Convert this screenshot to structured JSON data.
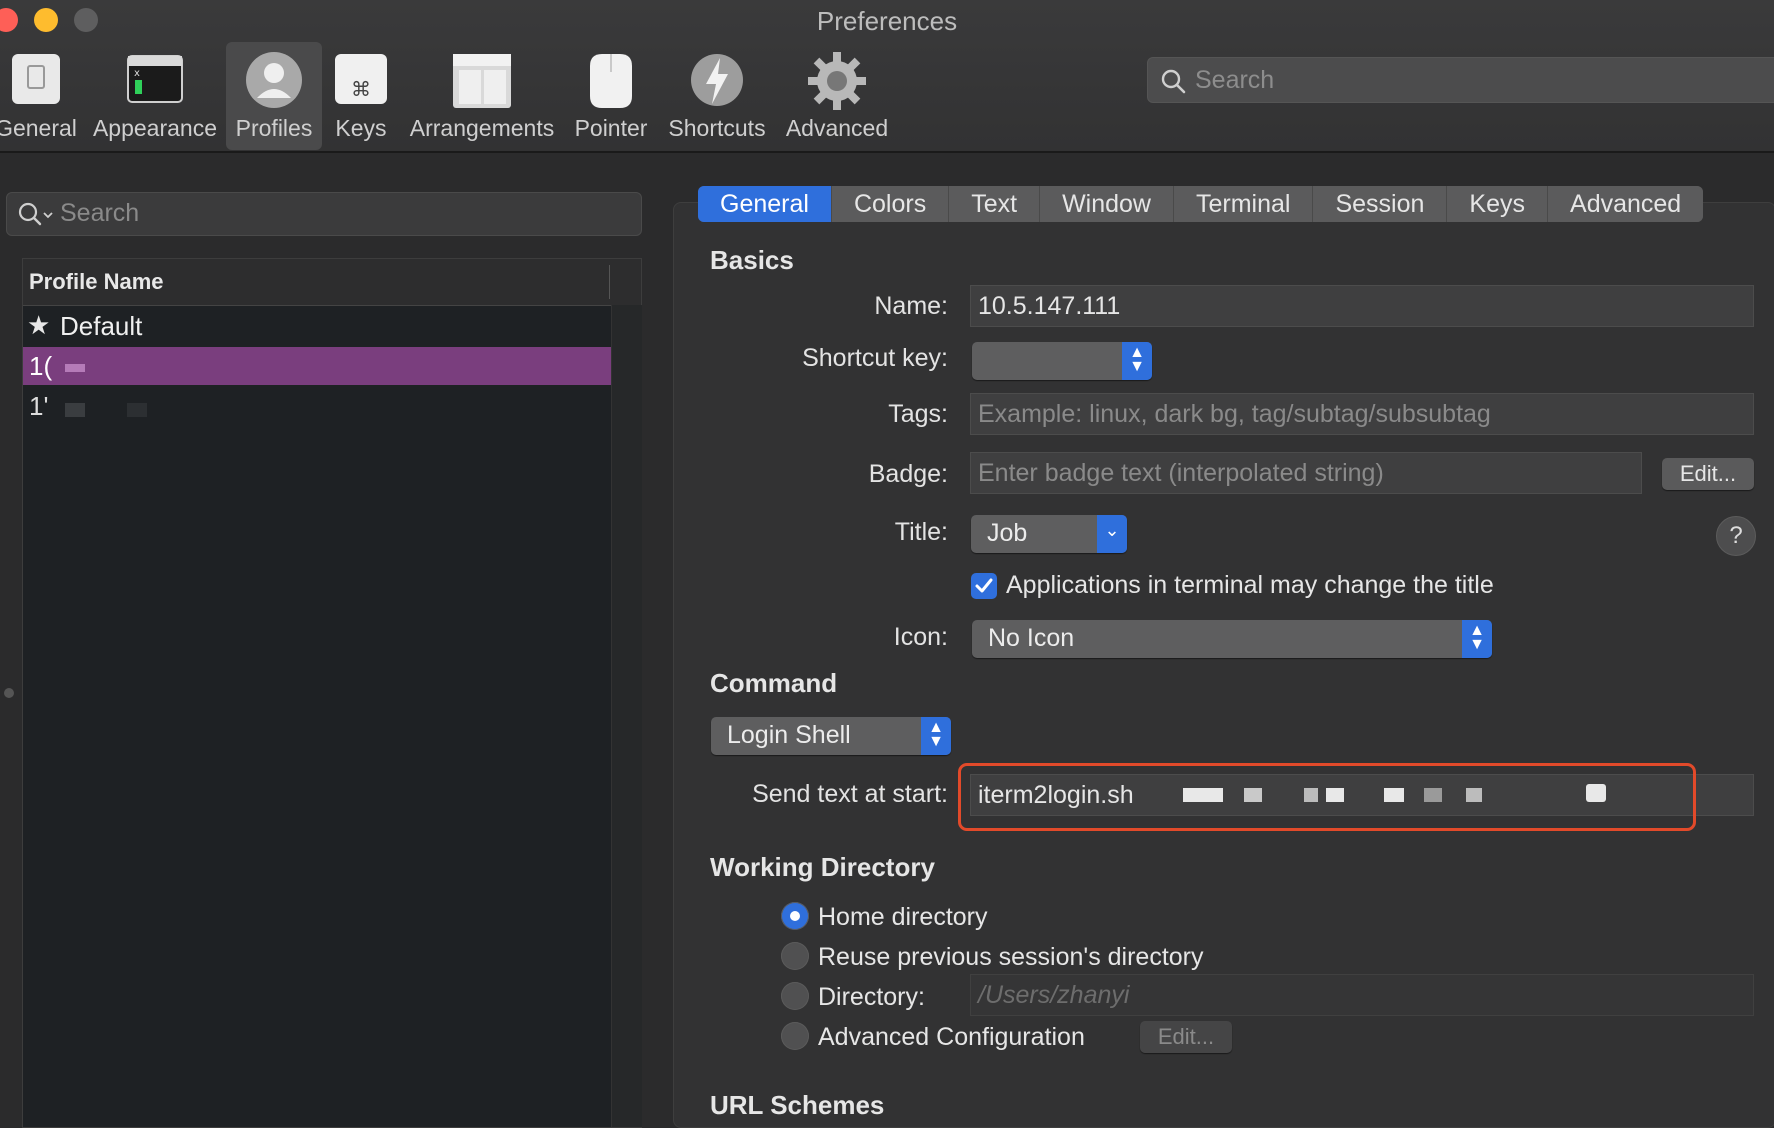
{
  "window": {
    "title": "Preferences"
  },
  "toolbar": {
    "items": [
      {
        "label": "General",
        "icon": "general-icon"
      },
      {
        "label": "Appearance",
        "icon": "appearance-icon"
      },
      {
        "label": "Profiles",
        "icon": "profiles-icon",
        "selected": true
      },
      {
        "label": "Keys",
        "icon": "keys-icon"
      },
      {
        "label": "Arrangements",
        "icon": "arrangements-icon"
      },
      {
        "label": "Pointer",
        "icon": "pointer-icon"
      },
      {
        "label": "Shortcuts",
        "icon": "shortcuts-icon"
      },
      {
        "label": "Advanced",
        "icon": "advanced-icon"
      }
    ],
    "search_placeholder": "Search"
  },
  "profiles": {
    "search_placeholder": "Search",
    "column_header": "Profile Name",
    "rows": [
      {
        "name": "Default",
        "default": true
      },
      {
        "name": "1(",
        "selected": true
      },
      {
        "name": "1'"
      }
    ]
  },
  "tabs": [
    "General",
    "Colors",
    "Text",
    "Window",
    "Terminal",
    "Session",
    "Keys",
    "Advanced"
  ],
  "basics": {
    "heading": "Basics",
    "name_label": "Name:",
    "name_value": "10.5.147.111",
    "shortcut_label": "Shortcut key:",
    "tags_label": "Tags:",
    "tags_placeholder": "Example: linux, dark bg, tag/subtag/subsubtag",
    "badge_label": "Badge:",
    "badge_placeholder": "Enter badge text (interpolated string)",
    "badge_edit": "Edit...",
    "title_label": "Title:",
    "title_value": "Job",
    "help": "?",
    "checkbox_label": "Applications in terminal may change the title",
    "icon_label": "Icon:",
    "icon_value": "No Icon"
  },
  "command": {
    "heading": "Command",
    "mode": "Login Shell",
    "send_text_label": "Send text at start:",
    "send_text_value": "iterm2login.sh"
  },
  "working_directory": {
    "heading": "Working Directory",
    "options": [
      "Home directory",
      "Reuse previous session's directory",
      "Directory:",
      "Advanced Configuration"
    ],
    "directory_placeholder": "/Users/zhanyi",
    "edit_label": "Edit..."
  },
  "url_schemes": {
    "heading": "URL Schemes"
  },
  "colors": {
    "accent": "#2f6fdc",
    "selected_row": "#7a3e7e",
    "highlight_box": "#e24a2a"
  }
}
